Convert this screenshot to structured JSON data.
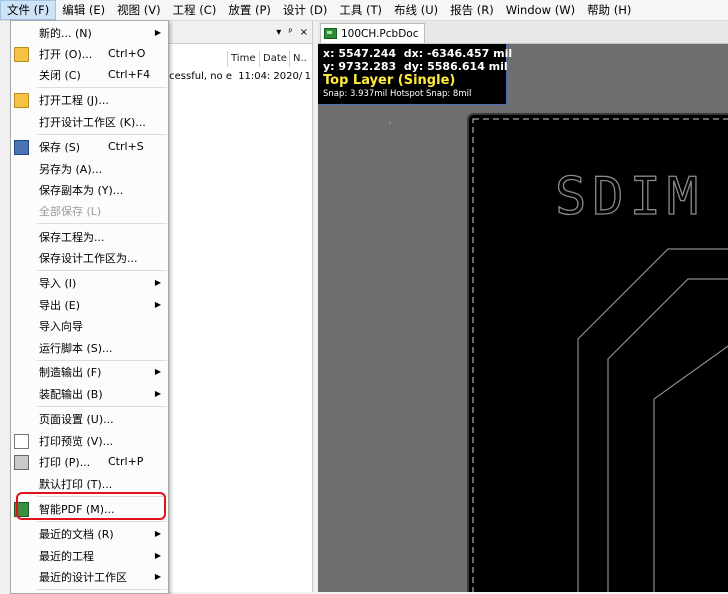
{
  "menubar": {
    "items": [
      {
        "label": "文件 (F)"
      },
      {
        "label": "编辑 (E)"
      },
      {
        "label": "视图 (V)"
      },
      {
        "label": "工程 (C)"
      },
      {
        "label": "放置 (P)"
      },
      {
        "label": "设计 (D)"
      },
      {
        "label": "工具 (T)"
      },
      {
        "label": "布线 (U)"
      },
      {
        "label": "报告 (R)"
      },
      {
        "label": "Window (W)"
      },
      {
        "label": "帮助 (H)"
      }
    ]
  },
  "panel": {
    "controls": [
      "▾",
      "ᵖ",
      "×"
    ],
    "columns": [
      "Time",
      "Date",
      "N.."
    ],
    "row": {
      "text": "ccessful, no e",
      "time": "11:04:",
      "date": "2020/",
      "no": "1"
    }
  },
  "doc_tab": {
    "label": "100CH.PcbDoc"
  },
  "hud": {
    "x": "x:  5547.244",
    "dx": "dx: -6346.457 mil",
    "y": "y:  9732.283",
    "dy": "dy:  5586.614 mil",
    "layer": "Top Layer (Single)",
    "snap": "Snap: 3.937mil Hotspot Snap: 8mil"
  },
  "board": {
    "silk_text": "SDIM"
  },
  "file_menu": {
    "items": [
      {
        "label": "新的... (N)",
        "arrow": "▶"
      },
      {
        "label": "打开 (O)...",
        "shortcut": "Ctrl+O",
        "icon": "open-folder-icon"
      },
      {
        "label": "关闭 (C)",
        "shortcut": "Ctrl+F4"
      },
      {
        "label": "打开工程 (J)...",
        "icon": "open-project-icon"
      },
      {
        "label": "打开设计工作区 (K)..."
      },
      {
        "label": "保存 (S)",
        "shortcut": "Ctrl+S",
        "icon": "save-icon"
      },
      {
        "label": "另存为 (A)..."
      },
      {
        "label": "保存副本为 (Y)..."
      },
      {
        "label": "全部保存 (L)",
        "disabled": true
      },
      {
        "label": "保存工程为..."
      },
      {
        "label": "保存设计工作区为..."
      },
      {
        "label": "导入 (I)",
        "arrow": "▶"
      },
      {
        "label": "导出 (E)",
        "arrow": "▶"
      },
      {
        "label": "导入向导"
      },
      {
        "label": "运行脚本 (S)..."
      },
      {
        "label": "制造输出 (F)",
        "arrow": "▶"
      },
      {
        "label": "装配输出 (B)",
        "arrow": "▶"
      },
      {
        "label": "页面设置 (U)..."
      },
      {
        "label": "打印预览 (V)...",
        "icon": "print-preview-icon"
      },
      {
        "label": "打印 (P)...",
        "shortcut": "Ctrl+P",
        "icon": "print-icon"
      },
      {
        "label": "默认打印 (T)..."
      },
      {
        "label": "智能PDF (M)...",
        "icon": "smart-pdf-icon",
        "highlighted": true
      },
      {
        "label": "最近的文档 (R)",
        "arrow": "▶"
      },
      {
        "label": "最近的工程",
        "arrow": "▶"
      },
      {
        "label": "最近的设计工作区",
        "arrow": "▶"
      }
    ]
  },
  "colors": {
    "highlight": "#e2111b",
    "layer_text": "#ffeb3b",
    "canvas": "#6e6e6e",
    "board": "#000000"
  }
}
